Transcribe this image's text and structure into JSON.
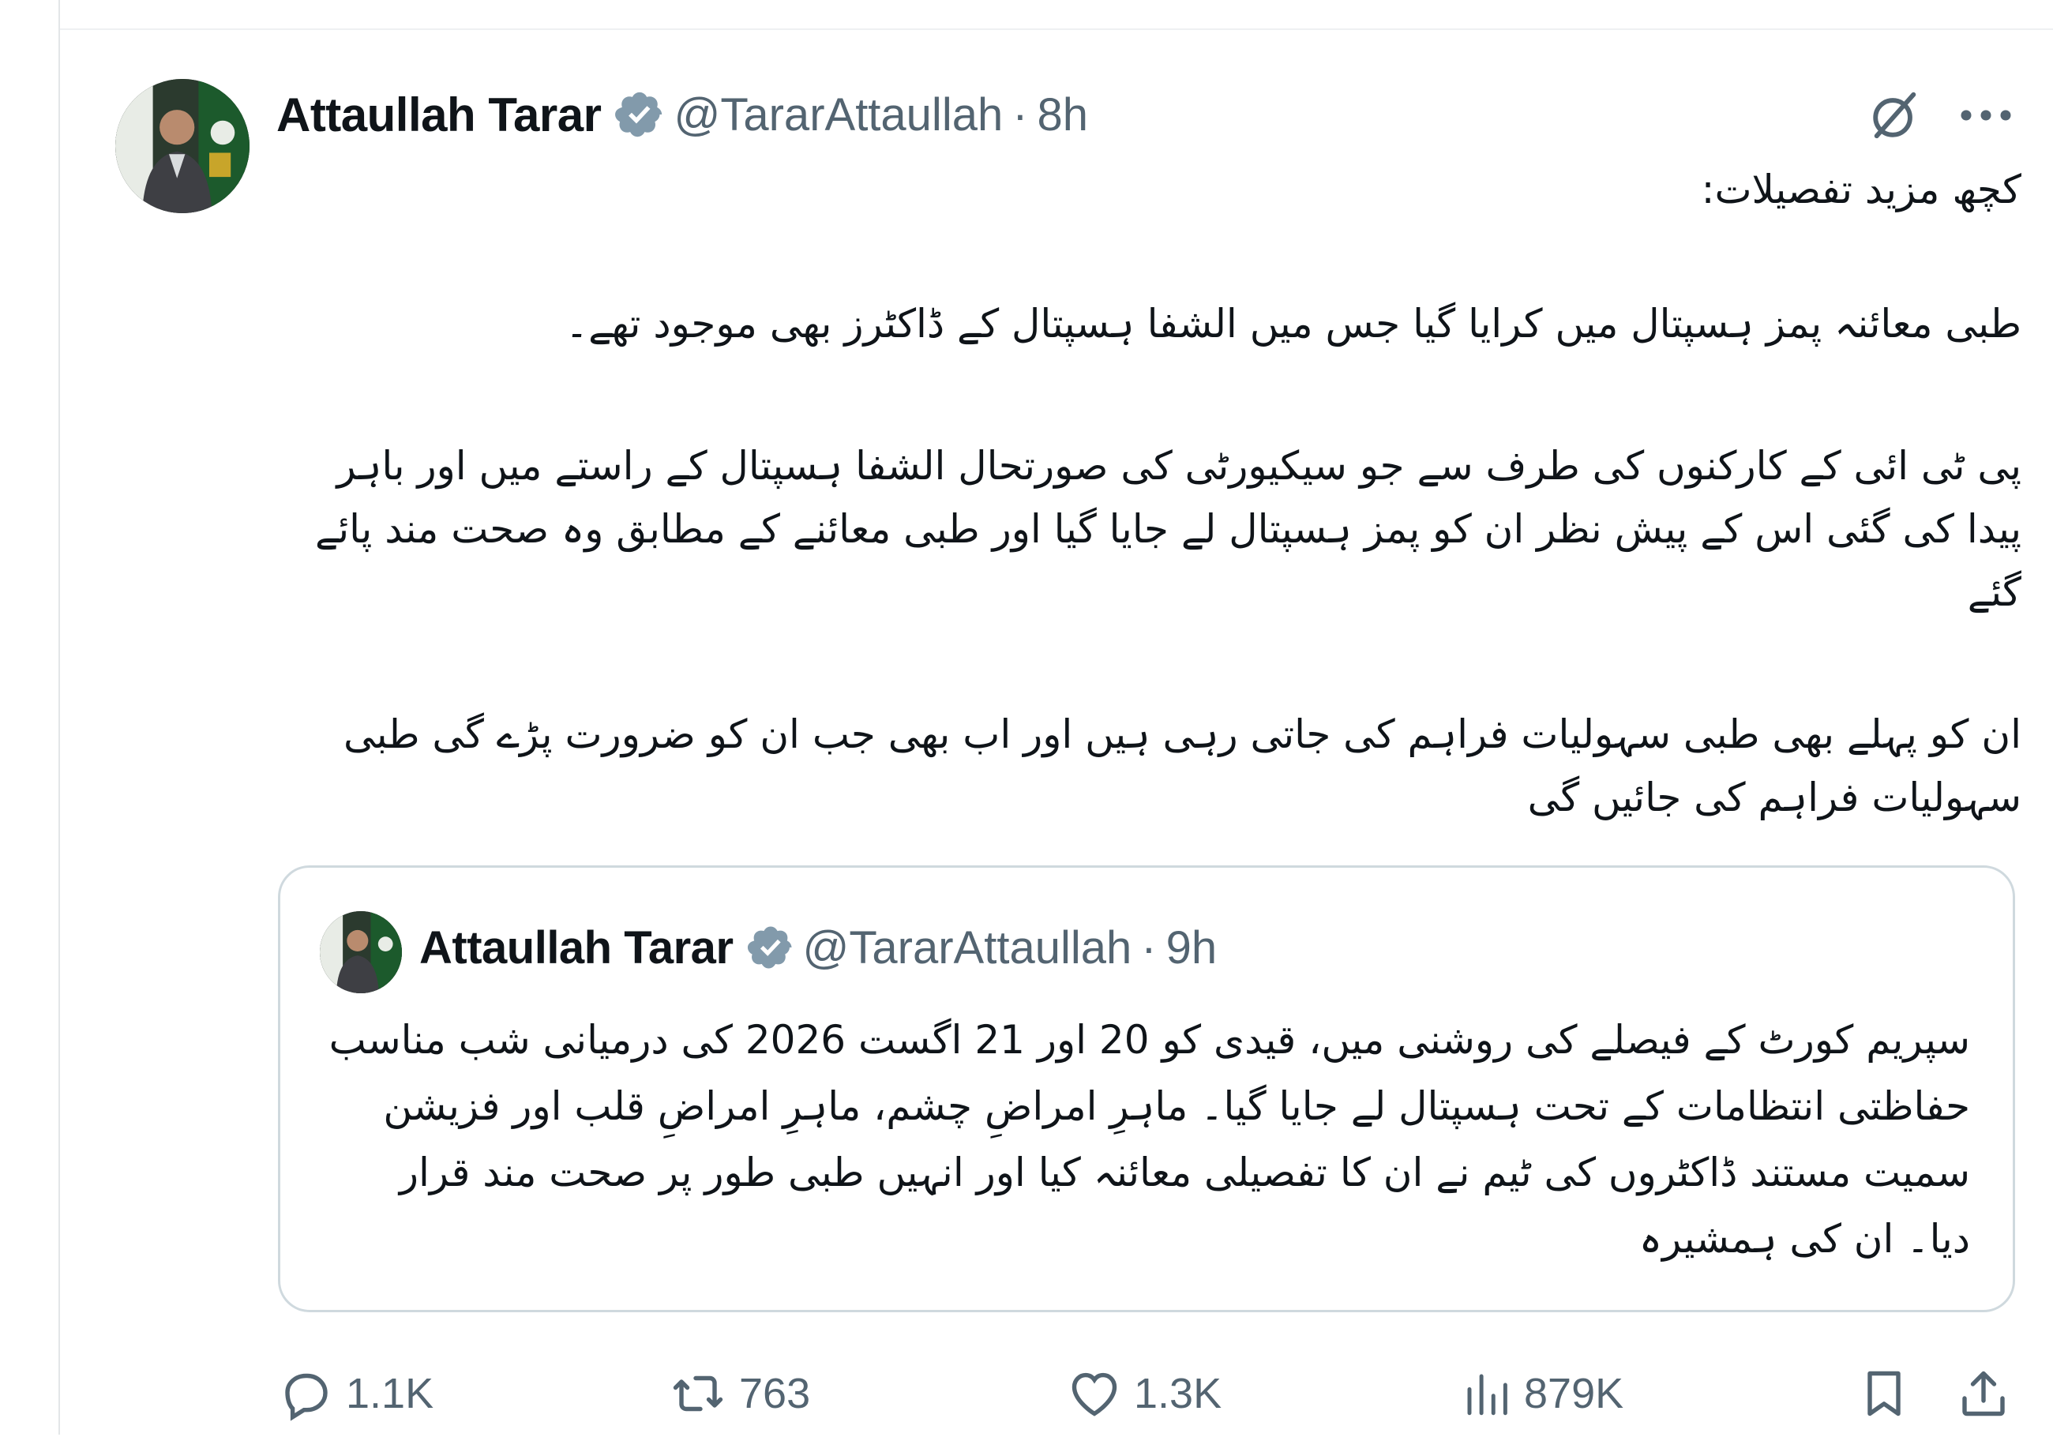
{
  "tweet": {
    "author": {
      "name": "Attaullah Tarar",
      "handle": "@TararAttaullah",
      "time": "8h",
      "verified": true,
      "avatar_icon": "profile-photo"
    },
    "paragraphs": [
      "کچھ مزید تفصیلات:",
      "طبی معائنہ پمز ہسپتال میں کرایا گیا جس میں الشفا ہسپتال کے ڈاکٹرز بھی موجود تھے۔",
      "پی ٹی ائی کے کارکنوں کی طرف سے جو سیکیورٹی کی صورتحال الشفا ہسپتال کے راستے میں اور باہر پیدا کی گئی اس کے پیش نظر ان کو پمز ہسپتال لے جایا گیا اور طبی معائنے کے مطابق وہ صحت مند پائے گئے",
      "ان کو پہلے بھی طبی سہولیات فراہم کی جاتی رہی ہیں اور اب بھی جب ان کو ضرورت پڑے گی طبی سہولیات فراہم کی جائیں گی"
    ],
    "header_icons": [
      "grok-icon",
      "more-icon"
    ],
    "dot": "·"
  },
  "quoted": {
    "author": {
      "name": "Attaullah Tarar",
      "handle": "@TararAttaullah",
      "time": "9h",
      "verified": true
    },
    "text": "سپریم کورٹ کے فیصلے کی روشنی میں، قیدی کو 20 اور 21 اگست 2026 کی درمیانی شب مناسب حفاظتی انتظامات کے تحت ہسپتال لے جایا گیا۔ ماہرِ امراضِ چشم، ماہرِ امراضِ قلب اور فزیشن سمیت مستند ڈاکٹروں کی ٹیم نے ان کا تفصیلی معائنہ کیا اور انہیں طبی طور پر صحت مند قرار دیا۔ ان کی ہمشیرہ"
  },
  "actions": {
    "replies": "1.1K",
    "retweets": "763",
    "likes": "1.3K",
    "views": "879K"
  },
  "colors": {
    "text": "#0f1419",
    "muted": "#536471",
    "border": "#cfd9de",
    "verified": "#829aab"
  }
}
